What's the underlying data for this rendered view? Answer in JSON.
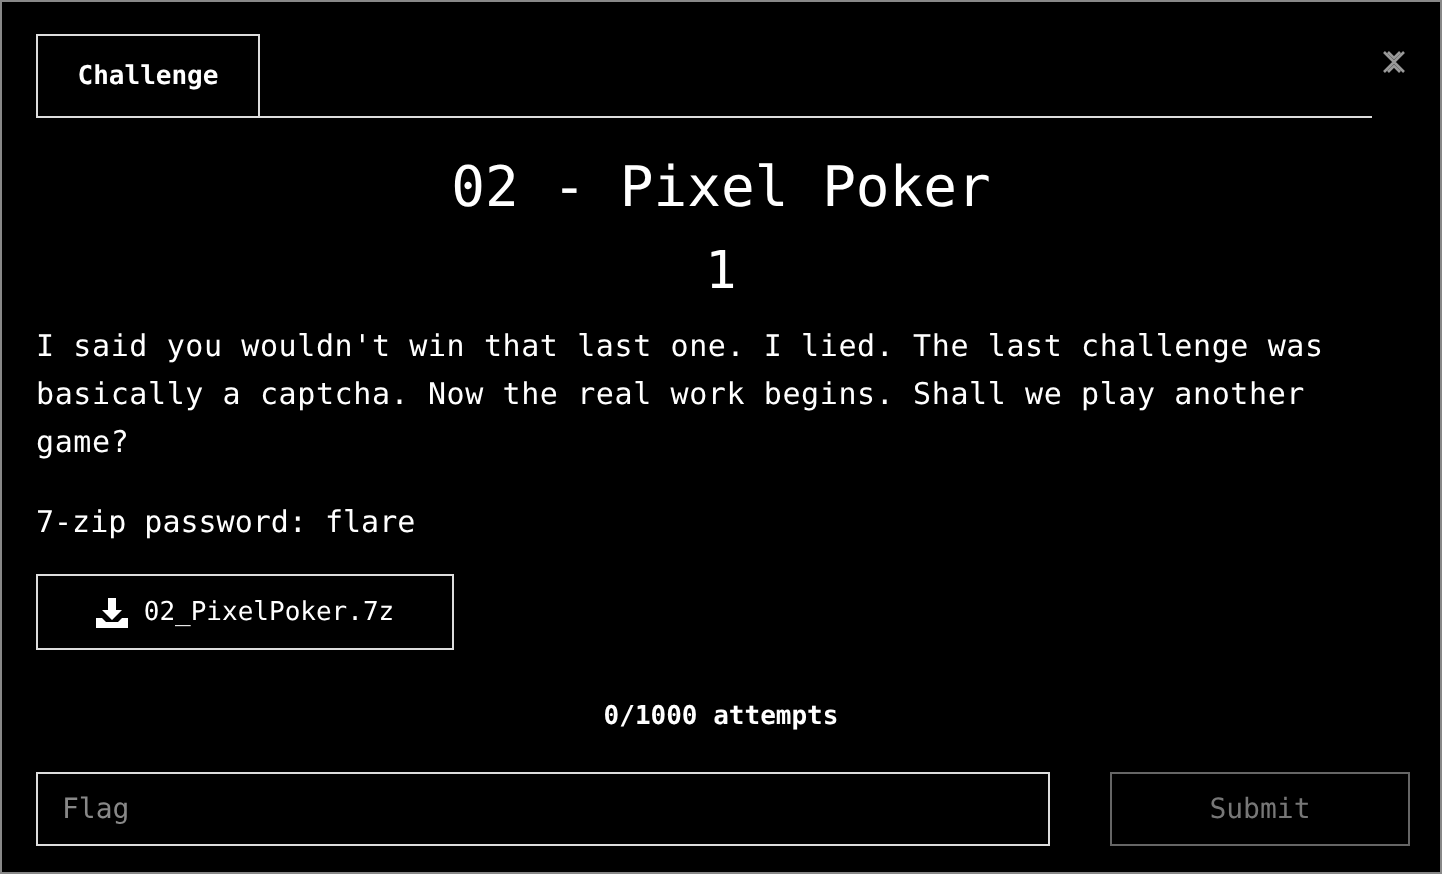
{
  "tabs": [
    {
      "label": "Challenge",
      "selected": true
    }
  ],
  "title": "02 - Pixel Poker",
  "points": "1",
  "description": "I said you wouldn't win that last one. I lied. The last challenge was basically a captcha. Now the real work begins. Shall we play another game?",
  "password_note": "7-zip password: flare",
  "download": {
    "label": "02_PixelPoker.7z"
  },
  "attempts": "0/1000 attempts",
  "flag_field": {
    "placeholder": "Flag"
  },
  "submit": {
    "label": "Submit",
    "disabled": true
  }
}
